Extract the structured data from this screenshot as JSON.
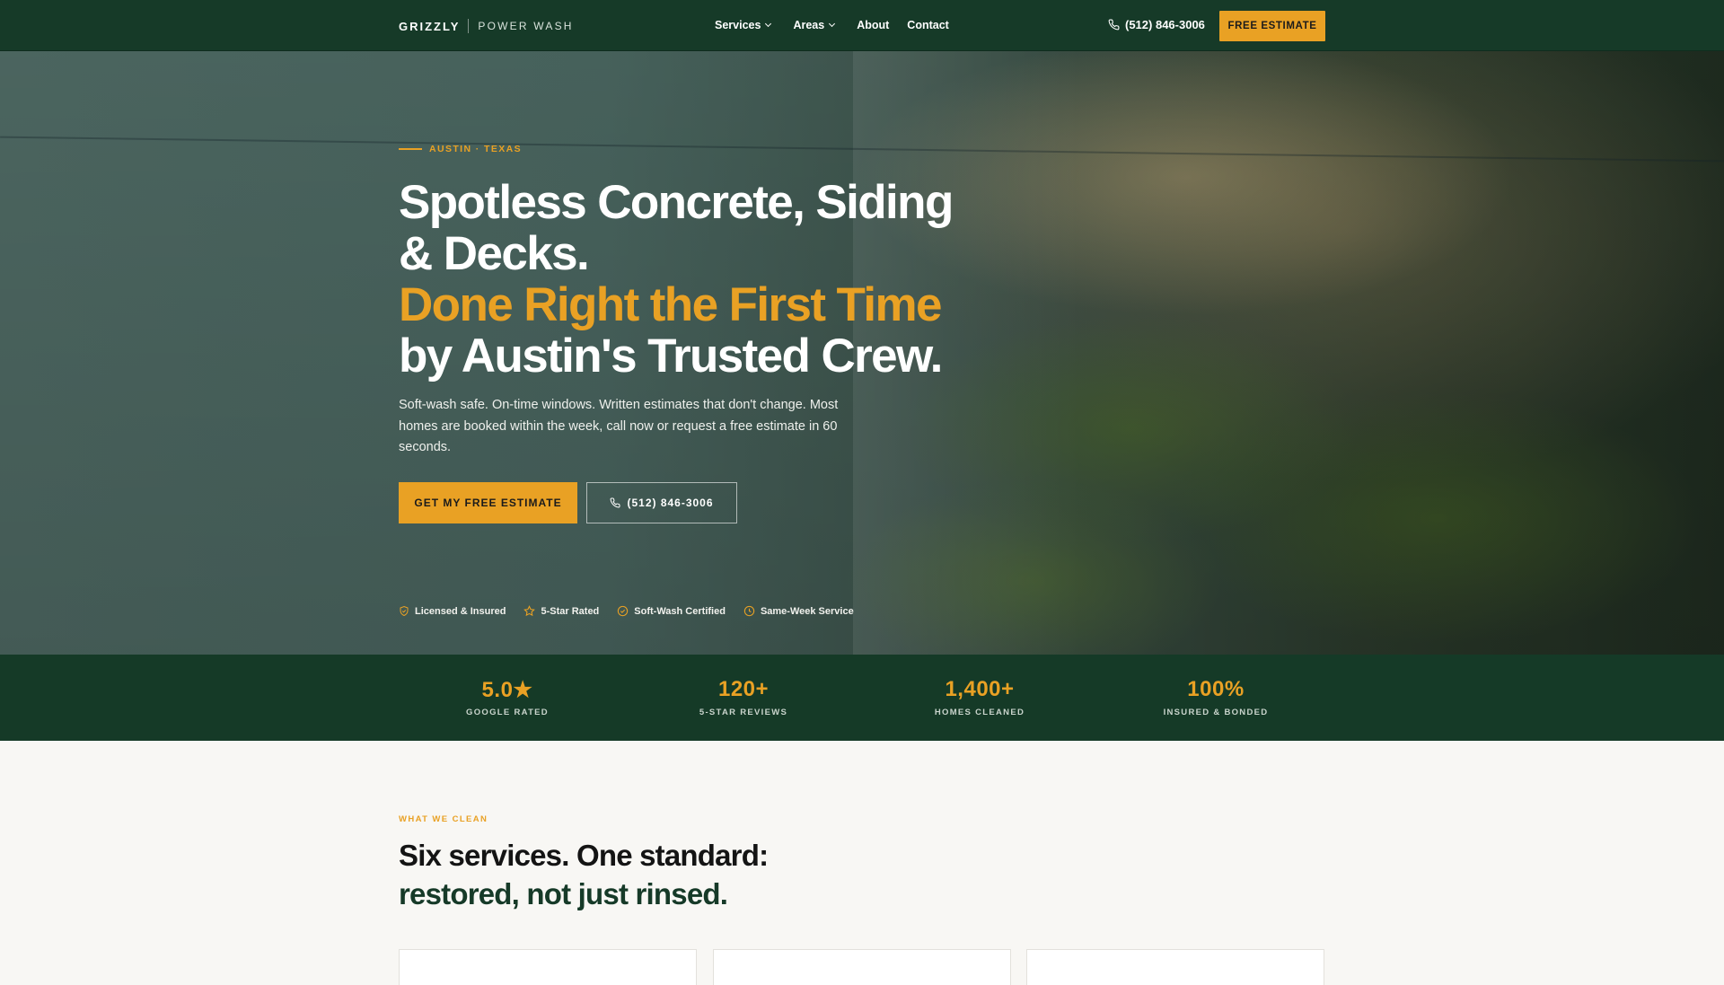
{
  "nav": {
    "brand_primary": "GRIZZLY",
    "brand_secondary": "POWER WASH",
    "links": [
      "Services",
      "Areas",
      "About",
      "Contact"
    ],
    "phone": "(512) 846-3006",
    "cta": "FREE ESTIMATE"
  },
  "hero": {
    "eyebrow": "AUSTIN · TEXAS",
    "headline_line1": "Spotless Concrete, Siding",
    "headline_line2": "& Decks.",
    "headline_line3": "Done Right the First Time",
    "headline_line4": "by Austin's Trusted Crew.",
    "subtext": "Soft-wash safe. On-time windows. Written estimates that don't change. Most homes are booked within the week, call now or request a free estimate in 60 seconds.",
    "primary_button": "GET MY FREE ESTIMATE",
    "secondary_button": "(512) 846-3006",
    "badges": [
      {
        "icon": "shield-check-icon",
        "label": "Licensed & Insured"
      },
      {
        "icon": "star-icon",
        "label": "5-Star Rated"
      },
      {
        "icon": "check-circle-icon",
        "label": "Soft-Wash Certified"
      },
      {
        "icon": "clock-icon",
        "label": "Same-Week Service"
      }
    ]
  },
  "stats": [
    {
      "value": "5.0★",
      "label": "GOOGLE RATED"
    },
    {
      "value": "120+",
      "label": "5-STAR REVIEWS"
    },
    {
      "value": "1,400+",
      "label": "HOMES CLEANED"
    },
    {
      "value": "100%",
      "label": "INSURED & BONDED"
    }
  ],
  "services_section": {
    "eyebrow": "WHAT WE CLEAN",
    "title_line1": "Six services. One standard:",
    "title_line2": "restored, not just rinsed."
  },
  "colors": {
    "brand_green": "#163a28",
    "accent_gold": "#e9a124"
  }
}
